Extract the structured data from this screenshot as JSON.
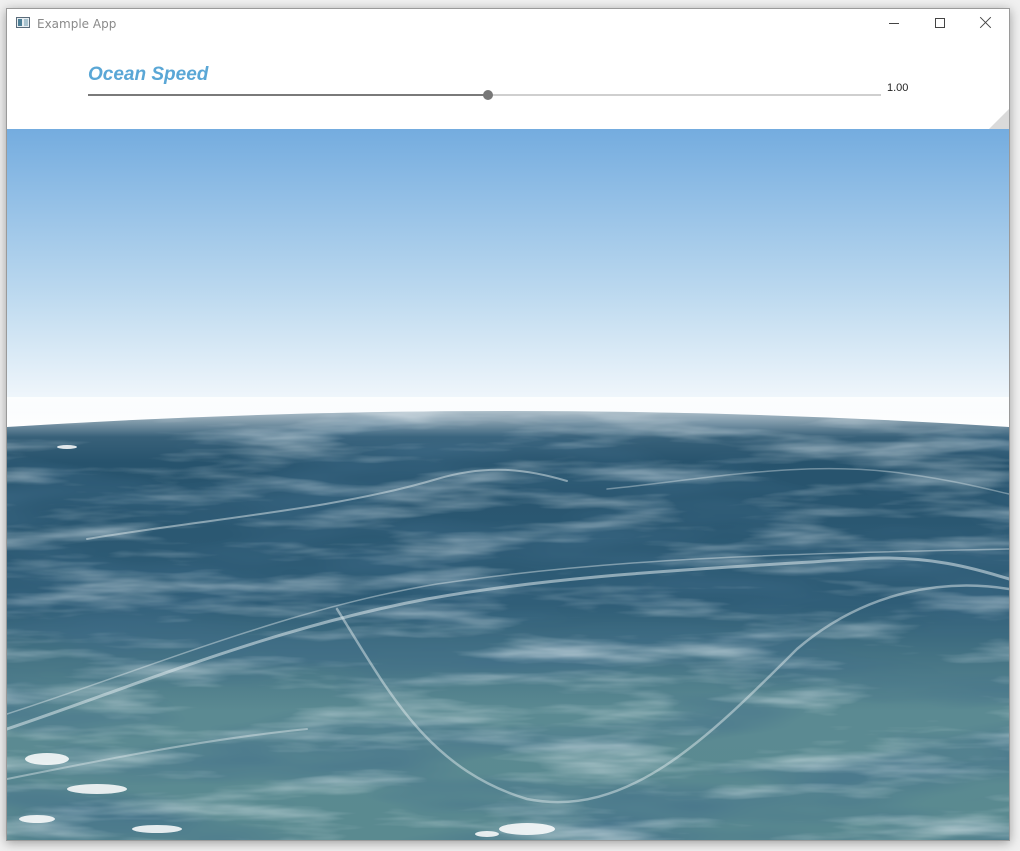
{
  "window": {
    "title": "Example App",
    "icon": "app-window-icon",
    "controls": [
      "minimize-icon",
      "maximize-icon",
      "close-icon"
    ]
  },
  "slider": {
    "label": "Ocean Speed",
    "value_text": "1.00",
    "fraction": 0.504,
    "label_color": "#5aa7d6"
  },
  "scene": {
    "sky_top_color": "#74acdf",
    "sky_horizon_color": "#ffffff",
    "sea_far_color": "#27536d",
    "sea_near_color": "#5b8a92"
  }
}
